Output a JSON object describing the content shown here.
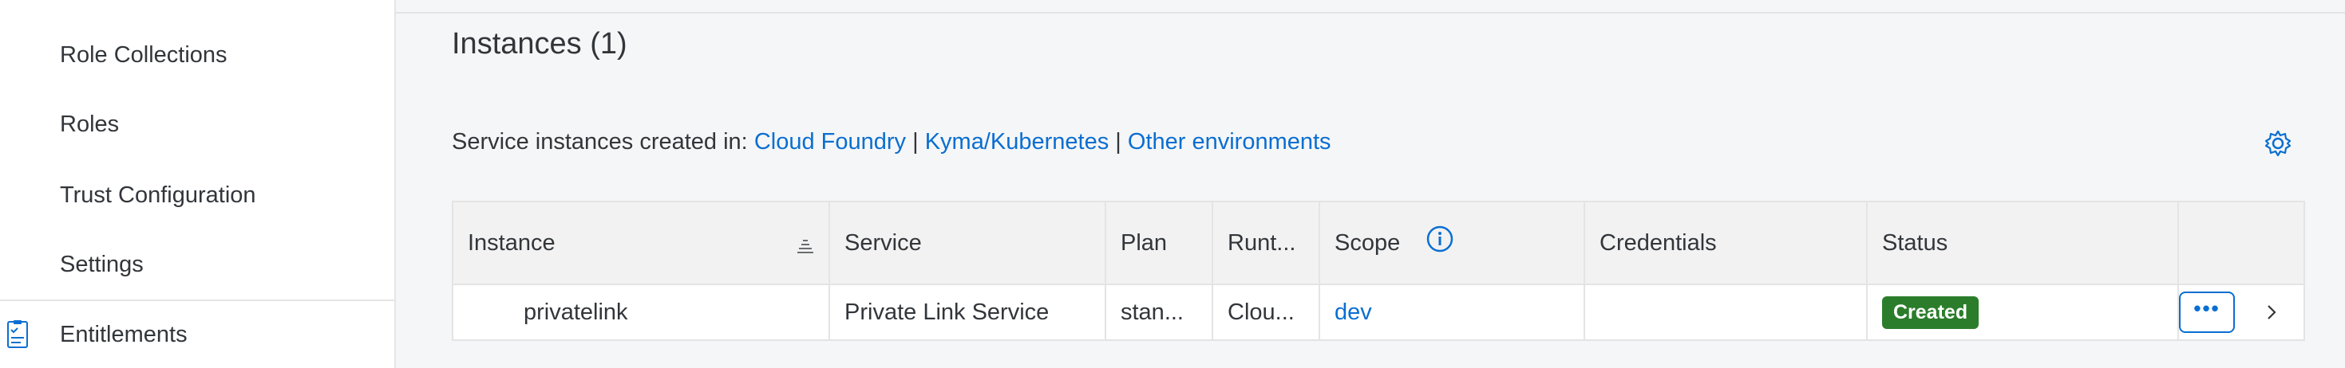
{
  "sidebar": {
    "items": [
      {
        "label": "Role Collections"
      },
      {
        "label": "Roles"
      },
      {
        "label": "Trust Configuration"
      },
      {
        "label": "Settings"
      },
      {
        "label": "Entitlements",
        "icon": "entitlements-icon"
      }
    ]
  },
  "main": {
    "title": "Instances (1)",
    "env_prefix": "Service instances created in:",
    "env_links": [
      "Cloud Foundry",
      "Kyma/Kubernetes",
      "Other environments"
    ],
    "env_separator": "|",
    "settings_icon": "gear-icon"
  },
  "table": {
    "columns": [
      "Instance",
      "Service",
      "Plan",
      "Runt...",
      "Scope",
      "Credentials",
      "Status",
      ""
    ],
    "rows": [
      {
        "instance": "privatelink",
        "service": "Private Link Service",
        "plan": "stan...",
        "runtime": "Clou...",
        "scope": "dev",
        "credentials": "",
        "status": "Created",
        "more_label": "•••"
      }
    ]
  },
  "colors": {
    "link": "#0a6ed1",
    "status_created": "#2b7d2b",
    "header_bg": "#f2f2f2"
  }
}
